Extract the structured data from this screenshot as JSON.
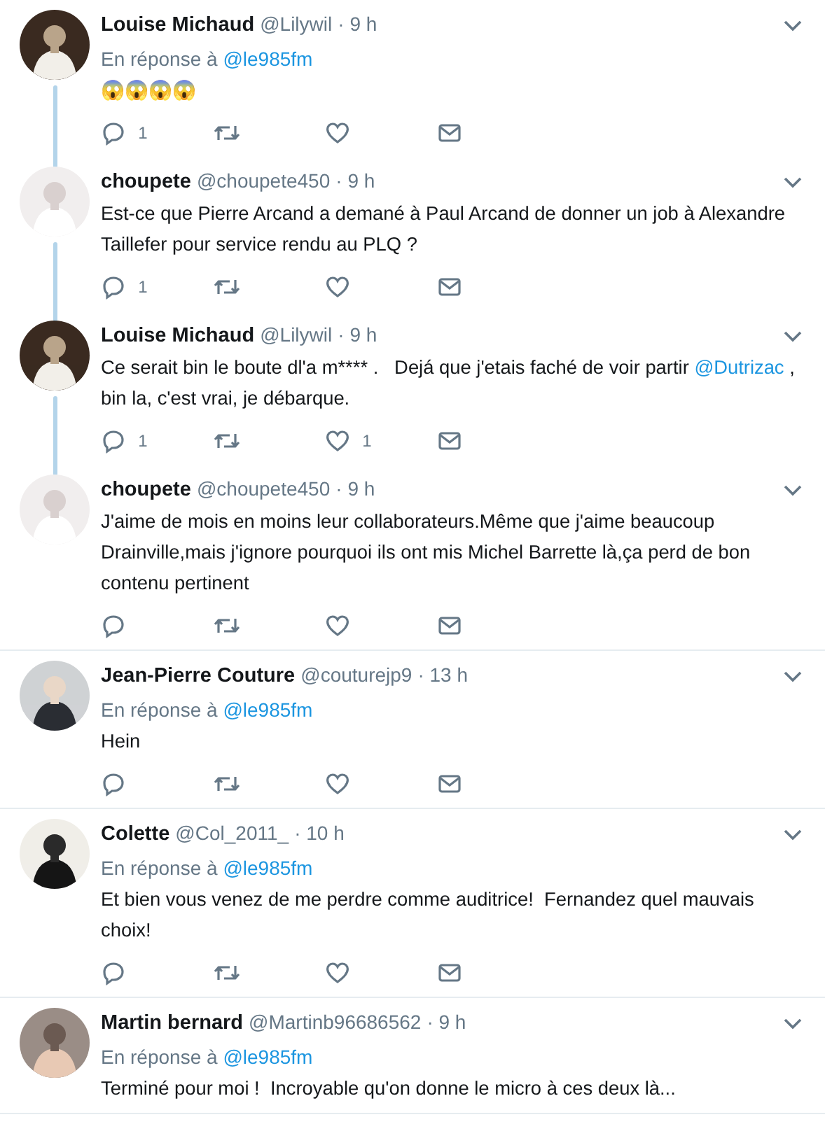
{
  "tweets": [
    {
      "name": "Louise Michaud",
      "handle": "@Lilywil",
      "time": "· 9 h",
      "reply_label": "En réponse à",
      "reply_to": "@le985fm",
      "body": [
        {
          "kind": "text",
          "text": "😱😱😱😱"
        }
      ],
      "show_actions": true,
      "reply_count": "1",
      "thread_below": true
    },
    {
      "name": "choupete",
      "handle": "@choupete450",
      "time": "· 9 h",
      "body": [
        {
          "kind": "text",
          "text": "Est-ce que Pierre Arcand a demané à Paul Arcand de donner un job à Alexandre Taillefer pour service rendu au PLQ ?"
        }
      ],
      "show_actions": true,
      "reply_count": "1",
      "thread_below": true
    },
    {
      "name": "Louise Michaud",
      "handle": "@Lilywil",
      "time": "· 9 h",
      "body": [
        {
          "kind": "text",
          "text": "Ce serait bin le boute dl'a m**** .   Dejá que j'etais faché de voir partir "
        },
        {
          "kind": "mention",
          "text": "@Dutrizac"
        },
        {
          "kind": "text",
          "text": " , bin la, c'est vrai, je débarque."
        }
      ],
      "show_actions": true,
      "reply_count": "1",
      "like_count": "1",
      "thread_below": true
    },
    {
      "name": "choupete",
      "handle": "@choupete450",
      "time": "· 9 h",
      "body": [
        {
          "kind": "text",
          "text": "J'aime de mois en moins leur collaborateurs.Même que j'aime beaucoup Drainville,mais j'ignore pourquoi ils ont mis Michel Barrette là,ça perd de bon contenu pertinent"
        }
      ],
      "show_actions": true,
      "thread_below": false
    },
    {
      "name": "Jean-Pierre Couture",
      "handle": "@couturejp9",
      "time": "· 13 h",
      "reply_label": "En réponse à",
      "reply_to": "@le985fm",
      "body": [
        {
          "kind": "text",
          "text": "Hein"
        }
      ],
      "show_actions": true,
      "thread_below": false
    },
    {
      "name": "Colette",
      "handle": "@Col_2011_",
      "time": "· 10 h",
      "reply_label": "En réponse à",
      "reply_to": "@le985fm",
      "body": [
        {
          "kind": "text",
          "text": "Et bien vous venez de me perdre comme auditrice!  Fernandez quel mauvais choix!"
        }
      ],
      "show_actions": true,
      "thread_below": false
    },
    {
      "name": "Martin bernard",
      "handle": "@Martinb96686562",
      "time": "· 9 h",
      "reply_label": "En réponse à",
      "reply_to": "@le985fm",
      "body": [
        {
          "kind": "text",
          "text": "Terminé pour moi !  Incroyable qu'on donne le micro à ces deux là..."
        }
      ],
      "show_actions": false,
      "thread_below": false
    }
  ]
}
